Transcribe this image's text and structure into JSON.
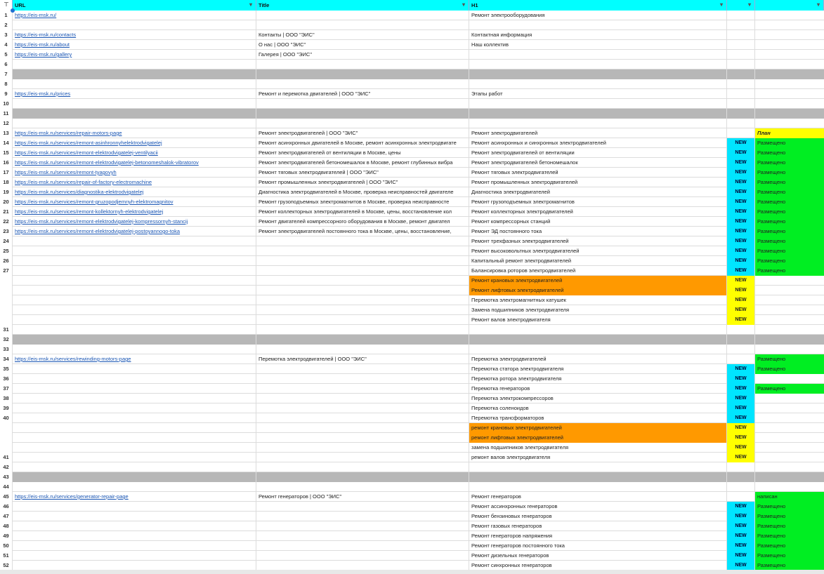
{
  "header": {
    "url": "URL",
    "title": "Title",
    "h1": "H1",
    "col_e": "",
    "col_f": ""
  },
  "icons": {
    "filter": "filter-icon"
  },
  "colors": {
    "header": "#00ffff",
    "separator": "#b7b7b7",
    "new": "#00e5ff",
    "new_alt": "#ffff00",
    "orange": "#ff9900",
    "green": "#00ee22",
    "plan": "#ffff00"
  },
  "rows": [
    {
      "num": "1",
      "url": "https://eis-msk.ru/",
      "title": "",
      "h1": "Ремонт электрооборудования",
      "e": "",
      "f": ""
    },
    {
      "num": "2",
      "url": "",
      "title": "",
      "h1": "",
      "e": "",
      "f": ""
    },
    {
      "num": "3",
      "url": "https://eis-msk.ru/contacts",
      "title": "Контакты | ООО \"ЭИС\"",
      "h1": "Контактная информация",
      "e": "",
      "f": ""
    },
    {
      "num": "4",
      "url": "https://eis-msk.ru/about",
      "title": "О нас | ООО \"ЭИС\"",
      "h1": "Наш коллектив",
      "e": "",
      "f": ""
    },
    {
      "num": "5",
      "url": "https://eis-msk.ru/gallery",
      "title": "Галерея | ООО \"ЭИС\"",
      "h1": "",
      "e": "",
      "f": ""
    },
    {
      "num": "6",
      "url": "",
      "title": "",
      "h1": "",
      "e": "",
      "f": ""
    },
    {
      "num": "7",
      "type": "gray"
    },
    {
      "num": "8",
      "url": "",
      "title": "",
      "h1": "",
      "e": "",
      "f": ""
    },
    {
      "num": "9",
      "url": "https://eis-msk.ru/prices",
      "title": "Ремонт и перемотка двигателей | ООО \"ЭИС\"",
      "h1": "Этапы работ",
      "e": "",
      "f": ""
    },
    {
      "num": "10",
      "url": "",
      "title": "",
      "h1": "",
      "e": "",
      "f": ""
    },
    {
      "num": "11",
      "type": "gray"
    },
    {
      "num": "12",
      "url": "",
      "title": "",
      "h1": "",
      "e": "",
      "f": ""
    },
    {
      "num": "13",
      "url": "https://eis-msk.ru/services/repair-motors-page",
      "title": "Ремонт электродвигателей | ООО \"ЭИС\"",
      "h1": "Ремонт электродвигателей",
      "e": "",
      "f": "План",
      "f_style": "yellow"
    },
    {
      "num": "14",
      "url": "https://eis-msk.ru/services/remont-asinhronnyhelektrodvigatelej",
      "title": "Ремонт асинхронных двигателей в Москве, ремонт асинхронных электродвигате",
      "h1": "Ремонт асинхронных и синхронных электродвигателей",
      "e": "NEW",
      "e_style": "new",
      "f": "Размещено",
      "f_style": "green"
    },
    {
      "num": "15",
      "url": "https://eis-msk.ru/services/remont-elektrodvigatelej-ventilyacii",
      "title": "Ремонт электродвигателей от вентиляции в Москве, цены",
      "h1": "Ремонт электродвигателей от вентиляции",
      "e": "NEW",
      "e_style": "new",
      "f": "Размещено",
      "f_style": "green"
    },
    {
      "num": "16",
      "url": "https://eis-msk.ru/services/remont-elektrodvigatelej-betonomeshalok-vibratorov",
      "title": "Ремонт электродвигателей бетономешалок в Москве, ремонт глубинных вибра",
      "h1": "Ремонт электродвигателей бетономешалок",
      "e": "NEW",
      "e_style": "new",
      "f": "Размещено",
      "f_style": "green"
    },
    {
      "num": "17",
      "url": "https://eis-msk.ru/services/remont-tyagovyh",
      "title": "Ремонт тяговых электродвигателей | ООО \"ЭИС\"",
      "h1": "Ремонт тяговых электродвигателей",
      "e": "NEW",
      "e_style": "new",
      "f": "Размещено",
      "f_style": "green"
    },
    {
      "num": "18",
      "url": "https://eis-msk.ru/services/repair-of-factory-electromachine",
      "title": "Ремонт промышленных электродвигателей | ООО \"ЭИС\"",
      "h1": "Ремонт промышленных электродвигателей",
      "e": "NEW",
      "e_style": "new",
      "f": "Размещено",
      "f_style": "green"
    },
    {
      "num": "19",
      "url": "https://eis-msk.ru/services/diagnostika-elektrodvigatelej",
      "title": "Диагностика электродвигателей в Москве, проверка неисправностей двигателе",
      "h1": "Диагностика электродвигателей",
      "e": "NEW",
      "e_style": "new",
      "f": "Размещено",
      "f_style": "green"
    },
    {
      "num": "20",
      "url": "https://eis-msk.ru/services/remont-gruzopodjemnyh-elektromagnitov",
      "title": "Ремонт грузоподъемных электромагнитов в Москве, проверка неисправносте",
      "h1": "Ремонт грузоподъемных электромагнитов",
      "e": "NEW",
      "e_style": "new",
      "f": "Размещено",
      "f_style": "green"
    },
    {
      "num": "21",
      "url": "https://eis-msk.ru/services/remont-kollektornyh-elektrodvigatelej",
      "title": "Ремонт коллекторных электродвигателей в Москве, цены, восстановление кол",
      "h1": "Ремонт коллекторных электродвигателей",
      "e": "NEW",
      "e_style": "new",
      "f": "Размещено",
      "f_style": "green"
    },
    {
      "num": "22",
      "url": "https://eis-msk.ru/services/remont-elektrodvigatelej-kompressornyh-stancij",
      "title": "Ремонт двигателей компрессорного оборудования в Москве, ремонт двигател",
      "h1": "Ремонт компрессорных станций",
      "e": "NEW",
      "e_style": "new",
      "f": "Размещено",
      "f_style": "green"
    },
    {
      "num": "23",
      "url": "https://eis-msk.ru/services/remont-elektrodvigatelej-postoyannogo-toka",
      "title": "Ремонт электродвигателей постоянного тока в Москве, цены, восстановление,",
      "h1": "Ремонт ЭД постоянного тока",
      "e": "NEW",
      "e_style": "new",
      "f": "Размещено",
      "f_style": "green"
    },
    {
      "num": "24",
      "url": "",
      "title": "",
      "h1": "Ремонт трехфазных электродвигателей",
      "e": "NEW",
      "e_style": "new",
      "f": "Размещено",
      "f_style": "green"
    },
    {
      "num": "25",
      "url": "",
      "title": "",
      "h1": "Ремонт высоковольтных электродвигателей",
      "e": "NEW",
      "e_style": "new",
      "f": "Размещено",
      "f_style": "green"
    },
    {
      "num": "26",
      "url": "",
      "title": "",
      "h1": "Капитальный ремонт электродвигателей",
      "e": "NEW",
      "e_style": "new",
      "f": "Размещено",
      "f_style": "green"
    },
    {
      "num": "27",
      "url": "",
      "title": "",
      "h1": "Балансировка роторов электродвигателей",
      "e": "NEW",
      "e_style": "new",
      "f": "Размещено",
      "f_style": "green"
    },
    {
      "num": "",
      "url": "",
      "title": "",
      "h1": "Ремонт крановых электродвигателей",
      "h1_style": "orange",
      "e": "NEW",
      "e_style": "newy",
      "f": ""
    },
    {
      "num": "",
      "url": "",
      "title": "",
      "h1": "Ремонт лифтовых электродвигателей",
      "h1_style": "orange",
      "e": "NEW",
      "e_style": "newy",
      "f": ""
    },
    {
      "num": "",
      "url": "",
      "title": "",
      "h1": "Перемотка электромагнитных катушек",
      "e": "NEW",
      "e_style": "newy",
      "f": ""
    },
    {
      "num": "",
      "url": "",
      "title": "",
      "h1": "Замена подшипников электродвигателя",
      "e": "NEW",
      "e_style": "newy",
      "f": ""
    },
    {
      "num": "",
      "url": "",
      "title": "",
      "h1": "Ремонт валов электродвигателя",
      "e": "NEW",
      "e_style": "newy",
      "f": ""
    },
    {
      "num": "31",
      "url": "",
      "title": "",
      "h1": "",
      "e": "",
      "f": ""
    },
    {
      "num": "32",
      "type": "gray"
    },
    {
      "num": "33",
      "url": "",
      "title": "",
      "h1": "",
      "e": "",
      "f": ""
    },
    {
      "num": "34",
      "url": "https://eis-msk.ru/services/rewinding-motors-page",
      "title": "Перемотка электродвигателей | ООО \"ЭИС\"",
      "h1": "Перемотка электродвигателей",
      "e": "",
      "f": "Размещено",
      "f_style": "green"
    },
    {
      "num": "35",
      "url": "",
      "title": "",
      "h1": "Перемотка статора электродвигателя",
      "e": "NEW",
      "e_style": "new",
      "f": "Размещено",
      "f_style": "green"
    },
    {
      "num": "36",
      "url": "",
      "title": "",
      "h1": "Перемотка ротора электродвигателя",
      "e": "NEW",
      "e_style": "new",
      "f": ""
    },
    {
      "num": "37",
      "url": "",
      "title": "",
      "h1": "Перемотка генераторов",
      "e": "NEW",
      "e_style": "new",
      "f": "Размещено",
      "f_style": "green"
    },
    {
      "num": "38",
      "url": "",
      "title": "",
      "h1": "Перемотка электрокомпрессоров",
      "e": "NEW",
      "e_style": "new",
      "f": ""
    },
    {
      "num": "39",
      "url": "",
      "title": "",
      "h1": "Перемотка соленоидов",
      "e": "NEW",
      "e_style": "new",
      "f": ""
    },
    {
      "num": "40",
      "url": "",
      "title": "",
      "h1": "Перемотка трансформаторов",
      "e": "NEW",
      "e_style": "new",
      "f": ""
    },
    {
      "num": "",
      "url": "",
      "title": "",
      "h1": "ремонт крановых электродвигателей",
      "h1_style": "orange",
      "e": "NEW",
      "e_style": "newy",
      "f": ""
    },
    {
      "num": "",
      "url": "",
      "title": "",
      "h1": "ремонт лифтовых электродвигателей",
      "h1_style": "orange",
      "e": "NEW",
      "e_style": "newy",
      "f": ""
    },
    {
      "num": "",
      "url": "",
      "title": "",
      "h1": "замена подшипников электродвигателя",
      "e": "NEW",
      "e_style": "newy",
      "f": ""
    },
    {
      "num": "41",
      "url": "",
      "title": "",
      "h1": "ремонт валов электродвигателя",
      "e": "NEW",
      "e_style": "newy",
      "f": ""
    },
    {
      "num": "42",
      "url": "",
      "title": "",
      "h1": "",
      "e": "",
      "f": ""
    },
    {
      "num": "43",
      "type": "gray"
    },
    {
      "num": "44",
      "url": "",
      "title": "",
      "h1": "",
      "e": "",
      "f": ""
    },
    {
      "num": "45",
      "url": "https://eis-msk.ru/services/generator-repair-page",
      "title": "Ремонт генераторов | ООО \"ЭИС\"",
      "h1": "Ремонт генераторов",
      "e": "",
      "f": "написан",
      "f_style": "green"
    },
    {
      "num": "46",
      "url": "",
      "title": "",
      "h1": "Ремонт ассинхронных генераторов",
      "e": "NEW",
      "e_style": "new",
      "f": "Размещено",
      "f_style": "green"
    },
    {
      "num": "47",
      "url": "",
      "title": "",
      "h1": "Ремонт бензиновых генераторов",
      "e": "NEW",
      "e_style": "new",
      "f": "Размещено",
      "f_style": "green"
    },
    {
      "num": "48",
      "url": "",
      "title": "",
      "h1": "Ремонт газовых генераторов",
      "e": "NEW",
      "e_style": "new",
      "f": "Размещено",
      "f_style": "green"
    },
    {
      "num": "49",
      "url": "",
      "title": "",
      "h1": "Ремонт генераторов напряжения",
      "e": "NEW",
      "e_style": "new",
      "f": "Размещено",
      "f_style": "green"
    },
    {
      "num": "50",
      "url": "",
      "title": "",
      "h1": "Ремонт генераторов постоянного тока",
      "e": "NEW",
      "e_style": "new",
      "f": "Размещено",
      "f_style": "green"
    },
    {
      "num": "51",
      "url": "",
      "title": "",
      "h1": "Ремонт дизельных генераторов",
      "e": "NEW",
      "e_style": "new",
      "f": "Размещено",
      "f_style": "green"
    },
    {
      "num": "52",
      "url": "",
      "title": "",
      "h1": "Ремонт синхронных генераторов",
      "e": "NEW",
      "e_style": "new",
      "f": "Размещено",
      "f_style": "green"
    }
  ]
}
